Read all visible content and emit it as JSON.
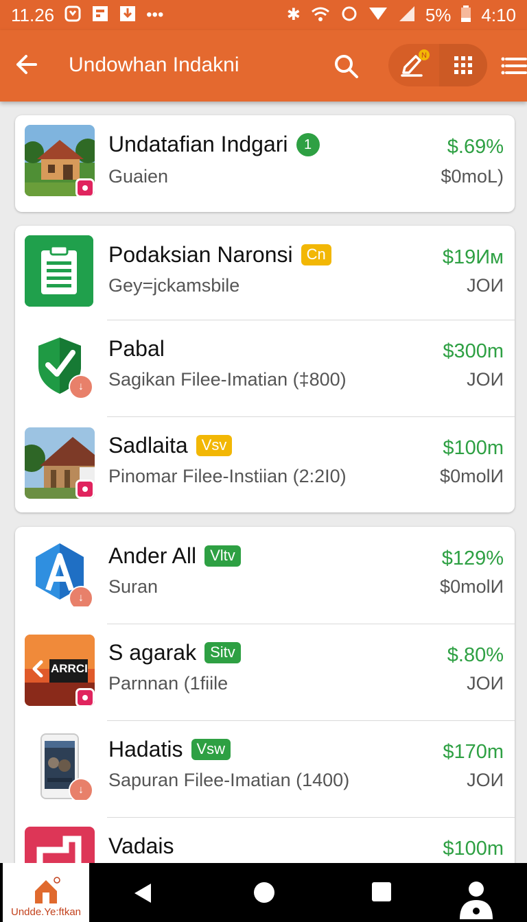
{
  "status_bar": {
    "time": "11.26",
    "battery": "5%",
    "clock": "4:10"
  },
  "app_bar": {
    "title": "Undowhan Indakni",
    "notify_badge": "N"
  },
  "cards": [
    {
      "rows": [
        {
          "title": "Undatafian Indgari",
          "tag": "1",
          "tag_style": "circle",
          "subtitle": "Guaien",
          "price": "$.69%",
          "meta": "$0moL)",
          "thumb": "house",
          "badge": "dot"
        }
      ]
    },
    {
      "rows": [
        {
          "title": "Podaksian Naronsi",
          "tag": "Cn",
          "tag_style": "yellow",
          "subtitle": "Gey=jckamsbile",
          "price": "$19Им",
          "meta": "JOИ",
          "thumb": "clipboard",
          "badge": "none"
        },
        {
          "title": "Pabal",
          "tag": "",
          "tag_style": "none",
          "subtitle": "Sagikan Filee-Imatian (‡800)",
          "price": "$300m",
          "meta": "JOИ",
          "thumb": "shield",
          "badge": "round"
        },
        {
          "title": "Sadlaita",
          "tag": "Vsv",
          "tag_style": "yellow",
          "subtitle": "Pinomar Filee-Instiian (2:2I0)",
          "price": "$100m",
          "meta": "$0molИ",
          "thumb": "cabin",
          "badge": "dot"
        }
      ]
    },
    {
      "rows": [
        {
          "title": "Ander All",
          "tag": "Vltv",
          "tag_style": "green",
          "subtitle": "Suran",
          "price": "$129%",
          "meta": "$0molИ",
          "thumb": "letter-a",
          "badge": "round"
        },
        {
          "title": "S agarak",
          "tag": "Sitv",
          "tag_style": "green",
          "subtitle": "Parnnan (1fiile",
          "price": "$.80%",
          "meta": "JOИ",
          "thumb": "sunset",
          "badge": "dot",
          "thumb_text": "ARRCI"
        },
        {
          "title": "Hadatis",
          "tag": "Vsw",
          "tag_style": "green",
          "subtitle": "Sapuran Filee-Imatian (1400)",
          "price": "$170m",
          "meta": "JOИ",
          "thumb": "phone",
          "badge": "round"
        },
        {
          "title": "Vadais",
          "tag": "",
          "tag_style": "none",
          "subtitle": "",
          "price": "$100m",
          "meta": "",
          "thumb": "red-app",
          "badge": "none"
        }
      ]
    }
  ],
  "bottom_nav": {
    "home_label": "Undde.Ye:ftkan"
  },
  "colors": {
    "accent": "#e4692f",
    "price_green": "#2ea043",
    "tag_yellow": "#f2b705"
  }
}
